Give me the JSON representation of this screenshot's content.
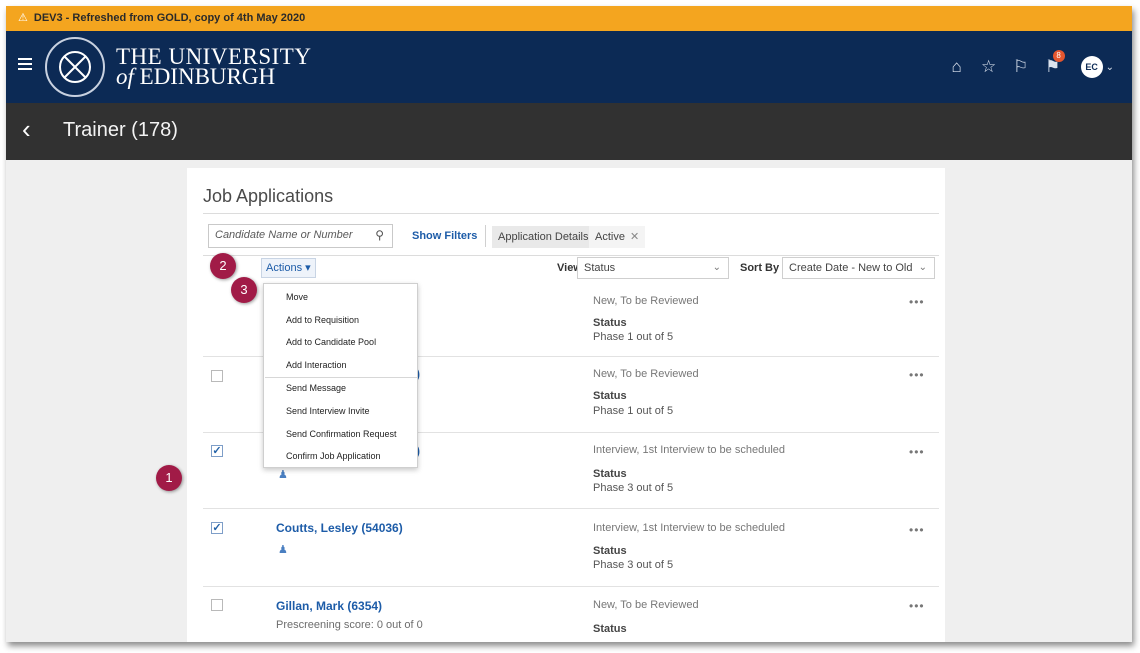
{
  "banner": {
    "icon": "warning-icon",
    "text": "DEV3 - Refreshed from GOLD, copy of 4th May 2020"
  },
  "header": {
    "brand_line1": "THE UNIVERSITY",
    "brand_line2_of": "of",
    "brand_line2": "EDINBURGH",
    "notification_count": "8",
    "avatar_initials": "EC",
    "icons": [
      "menu-icon",
      "home-icon",
      "star-icon",
      "flag-icon",
      "notification-icon",
      "chevron-down-icon"
    ]
  },
  "titlebar": {
    "title": "Trainer (178)"
  },
  "main": {
    "section_title": "Job Applications",
    "search_placeholder": "Candidate Name or Number",
    "show_filters": "Show Filters",
    "chip_label": "Application Details",
    "chip_value": "Active",
    "actions_label": "Actions",
    "view_label": "View",
    "view_value": "Status",
    "sort_label": "Sort By",
    "sort_value": "Create Date - New to Old"
  },
  "dropdown": {
    "items": [
      "Move",
      "Add to Requisition",
      "Add to Candidate Pool",
      "Add Interaction",
      "Send Message",
      "Send Interview Invite",
      "Send Confirmation Request",
      "Confirm Job Application"
    ]
  },
  "rows": [
    {
      "checked": false,
      "name": "",
      "status": "New, To be Reviewed",
      "status_label": "Status",
      "phase": "Phase 1 out of 5"
    },
    {
      "checked": false,
      "name": ")",
      "status": "New, To be Reviewed",
      "status_label": "Status",
      "phase": "Phase 1 out of 5"
    },
    {
      "checked": true,
      "name": ")",
      "status": "Interview, 1st Interview to be scheduled",
      "status_label": "Status",
      "phase": "Phase 3 out of 5"
    },
    {
      "checked": true,
      "name": "Coutts, Lesley (54036)",
      "status": "Interview, 1st Interview to be scheduled",
      "status_label": "Status",
      "phase": "Phase 3 out of 5"
    },
    {
      "checked": false,
      "name": "Gillan, Mark (6354)",
      "sub": "Prescreening score: 0 out of 0",
      "status": "New, To be Reviewed",
      "status_label": "Status",
      "phase": ""
    }
  ],
  "markers": [
    "1",
    "2",
    "3"
  ],
  "colors": {
    "banner": "#f4a51f",
    "header": "#0c2a55",
    "titlebar": "#313131",
    "marker": "#a11b47",
    "link": "#1d5ca8"
  }
}
